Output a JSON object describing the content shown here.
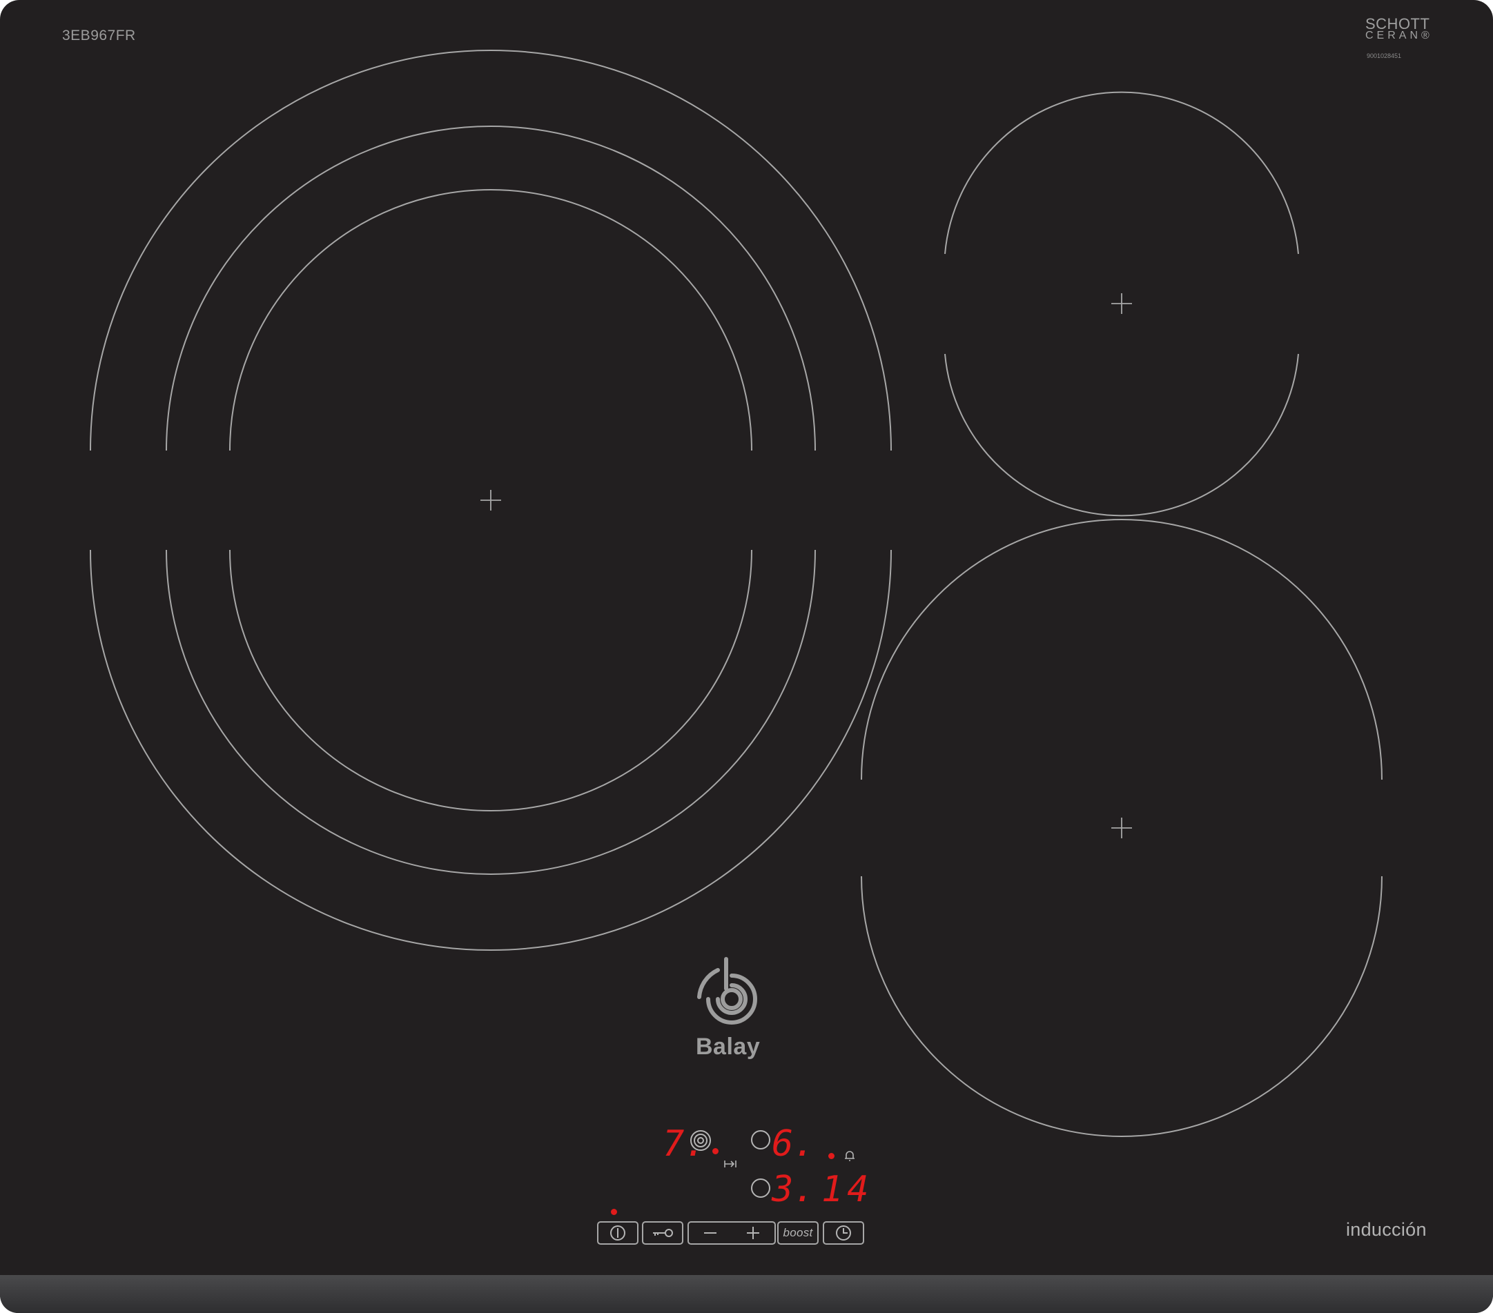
{
  "product": {
    "model": "3EB967FR",
    "glass_brand_line1": "SCHOTT",
    "glass_brand_line2": "CERAN®",
    "serial": "9001028451",
    "brand": "Balay",
    "type_label": "inducción"
  },
  "displays": {
    "zone_rear_left_level": "7.",
    "zone_rear_right_level": "6.",
    "zone_front_right_level": "3.",
    "timer_value": "14"
  },
  "controls": {
    "power_label": "⏻",
    "lock_label": "key-lock",
    "minus_label": "−",
    "plus_label": "+",
    "boost_label": "boost",
    "timer_label": "clock"
  },
  "icons": {
    "power_button": "power-icon",
    "lock_button": "key-icon",
    "timer_button": "clock-icon",
    "alarm": "bell-icon",
    "zone_active": "zone-rings-icon",
    "transfer": "arrow-bar-icon"
  },
  "colors": {
    "glass": "#221f20",
    "zone_outline": "#a7a7a7",
    "led_red": "#e11b1b",
    "print_gray": "#a6a6a6"
  }
}
